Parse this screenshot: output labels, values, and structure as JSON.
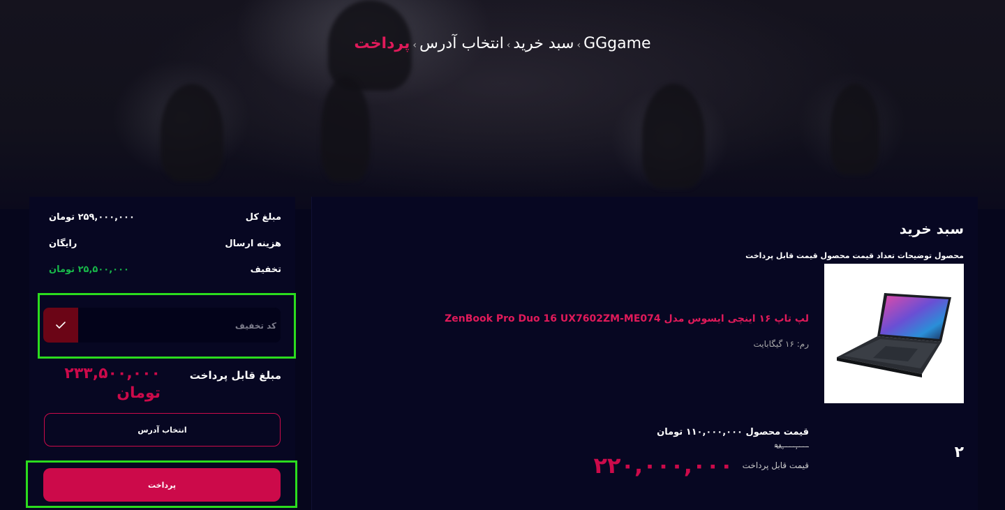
{
  "breadcrumb": {
    "items": [
      "GGgame",
      "سبد خرید",
      "انتخاب آدرس"
    ],
    "current": "پرداخت",
    "separator": "›"
  },
  "cart": {
    "title": "سبد خرید",
    "headers": "محصول توضیحات تعداد قیمت محصول قیمت قابل پرداخت",
    "product": {
      "name": "لپ تاپ ۱۶ اینچی ایسوس مدل ZenBook Pro Duo 16 UX7602ZM-ME074",
      "spec": "رم: ۱۶ گیگابایت",
      "quantity": "۲",
      "price_text": "قیمت محصول ۱۱۰,۰۰۰,۰۰۰ تومان",
      "old_price": "۹۸,۰۰۰,۰۰۰",
      "payable_label": "قیمت قابل پرداخت",
      "payable_value": "۲۲۰,۰۰۰,۰۰۰"
    }
  },
  "summary": {
    "total_label": "مبلغ کل",
    "total_value": "۲۵۹,۰۰۰,۰۰۰ تومان",
    "shipping_label": "هزینه ارسال",
    "shipping_value": "رایگان",
    "discount_label": "تخفیف",
    "discount_value": "۲۵,۵۰۰,۰۰۰ تومان",
    "coupon_placeholder": "کد تخفیف",
    "final_label": "مبلغ قابل پرداخت",
    "final_value": "۲۳۳,۵۰۰,۰۰۰ تومان",
    "address_button": "انتخاب آدرس",
    "pay_button": "پرداخت"
  },
  "colors": {
    "accent": "#cc0a4a",
    "discount": "#18b84a",
    "highlight": "#2bdc1e",
    "background": "#06061c"
  }
}
